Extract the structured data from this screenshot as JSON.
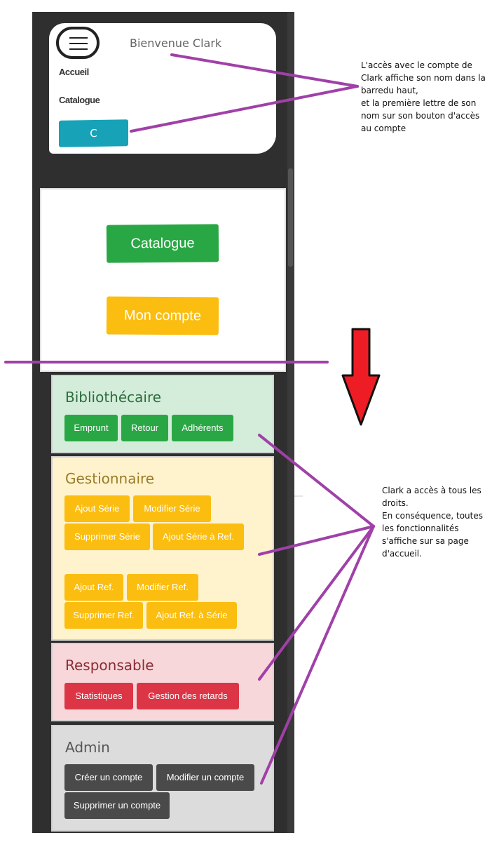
{
  "navbar": {
    "welcome": "Bienvenue Clark",
    "links": [
      "Accueil",
      "Catalogue"
    ],
    "account_initial": "C"
  },
  "home": {
    "catalog_label": "Catalogue",
    "account_label": "Mon compte"
  },
  "panels": {
    "bibliothecaire": {
      "title": "Bibliothécaire",
      "buttons": [
        "Emprunt",
        "Retour",
        "Adhérents"
      ]
    },
    "gestionnaire": {
      "title": "Gestionnaire",
      "buttons": [
        "Ajout Série",
        "Modifier Série",
        "Supprimer Série",
        "Ajout Série à Ref.",
        "Ajout Ref.",
        "Modifier Ref.",
        "Supprimer Ref.",
        "Ajout Ref. à Série"
      ]
    },
    "responsable": {
      "title": "Responsable",
      "buttons": [
        "Statistiques",
        "Gestion des retards"
      ]
    },
    "admin": {
      "title": "Admin",
      "buttons": [
        "Créer un compte",
        "Modifier un compte",
        "Supprimer un compte"
      ]
    }
  },
  "annotations": {
    "top_lines": [
      "L'accès avec le compte de",
      "Clark affiche son nom dans la",
      "barredu haut,",
      "et la première lettre de son",
      "nom sur son bouton d'accès",
      "au compte"
    ],
    "bottom_lines": [
      "Clark a accès à tous les",
      "droits.",
      "En conséquence, toutes",
      "les fonctionnalités",
      "s'affiche sur sa page",
      "d'accueil."
    ]
  },
  "colors": {
    "frame": "#2f2f2f",
    "info": "#17a2b8",
    "success": "#2aa745",
    "warning": "#fbbd10",
    "danger": "#dc3545",
    "dark": "#4a4a4a",
    "annotation_line": "#a040a8",
    "arrow": "#ee1c24"
  }
}
